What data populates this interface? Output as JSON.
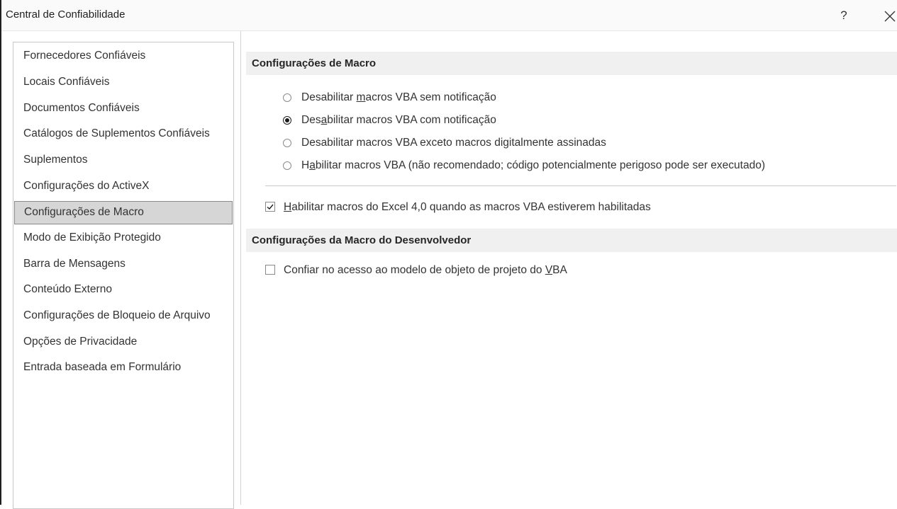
{
  "window": {
    "title": "Central de Confiabilidade",
    "help_label": "?"
  },
  "sidebar": {
    "selected_index": 6,
    "items": [
      {
        "label": "Fornecedores Confiáveis"
      },
      {
        "label": "Locais Confiáveis"
      },
      {
        "label": "Documentos Confiáveis"
      },
      {
        "label": "Catálogos de Suplementos Confiáveis"
      },
      {
        "label": "Suplementos"
      },
      {
        "label": "Configurações do ActiveX"
      },
      {
        "label": "Configurações de Macro"
      },
      {
        "label": "Modo de Exibição Protegido"
      },
      {
        "label": "Barra de Mensagens"
      },
      {
        "label": "Conteúdo Externo"
      },
      {
        "label": "Configurações de Bloqueio de Arquivo"
      },
      {
        "label": "Opções de Privacidade"
      },
      {
        "label": "Entrada baseada em Formulário"
      }
    ]
  },
  "macro_settings": {
    "header": "Configurações de Macro",
    "options": [
      {
        "pre": "Desabilitar ",
        "key": "m",
        "post": "acros VBA sem notificação",
        "checked": false
      },
      {
        "pre": "Des",
        "key": "a",
        "post": "bilitar macros VBA com notificação",
        "checked": true
      },
      {
        "pre": "Desabilitar macros VBA exceto macros di",
        "key": "g",
        "post": "italmente assinadas",
        "checked": false
      },
      {
        "pre": "H",
        "key": "a",
        "post": "bilitar macros VBA (não recomendado; código potencialmente perigoso pode ser executado)",
        "checked": false
      }
    ],
    "excel4": {
      "pre": "",
      "key": "H",
      "post": "abilitar macros do Excel 4,0 quando as macros VBA estiverem habilitadas",
      "checked": true
    }
  },
  "developer_settings": {
    "header": "Configurações da Macro do Desenvolvedor",
    "trust_vba": {
      "pre": "Confiar no acesso ao modelo de objeto de projeto do ",
      "key": "V",
      "post": "BA",
      "checked": false
    }
  },
  "icons": {
    "close": "close-icon",
    "checkmark": "checkmark-icon"
  }
}
